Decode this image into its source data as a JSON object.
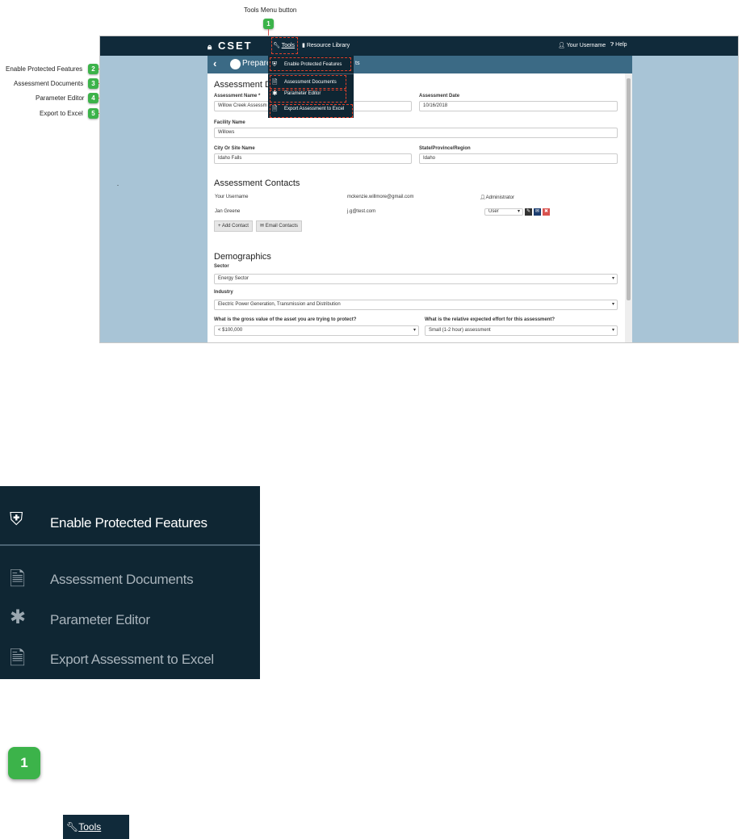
{
  "callouts": {
    "tools_menu_button": "Tools Menu button",
    "enable_protected_features": "Enable Protected Features",
    "assessment_documents": "Assessment Documents",
    "parameter_editor": "Parameter Editor",
    "export_to_excel": "Export to Excel",
    "badges": [
      "1",
      "2",
      "3",
      "4",
      "5"
    ]
  },
  "navbar": {
    "brand": "CSET",
    "tools": "Tools",
    "resource_library": "Resource Library",
    "username": "Your Username",
    "help": "Help"
  },
  "subheader": {
    "back": "‹",
    "title_visible": "Prepare",
    "tab_suffix": "ts"
  },
  "dropdown": {
    "items": [
      "Enable Protected Features",
      "Assessment Documents",
      "Parameter Editor",
      "Export Assessment to Excel"
    ]
  },
  "assessment_details": {
    "heading": "Assessment D",
    "name_label": "Assessment Name *",
    "name_value": "Willow Creek Assessm",
    "date_label": "Assessment Date",
    "date_value": "10/16/2018",
    "facility_label": "Facility Name",
    "facility_value": "Willows",
    "city_label": "City Or Site Name",
    "city_value": "Idaho Falls",
    "state_label": "State/Province/Region",
    "state_value": "Idaho"
  },
  "contacts": {
    "heading": "Assessment Contacts",
    "rows": [
      {
        "name": "Your Username",
        "email": "mckenzie.willmore@gmail.com",
        "role": "Administrator"
      },
      {
        "name": "Jan Greene",
        "email": "j.g@test.com",
        "role": "User"
      }
    ],
    "add_contact": "+ Add Contact",
    "email_contacts": "✉ Email Contacts"
  },
  "demographics": {
    "heading": "Demographics",
    "sector_label": "Sector",
    "sector_value": "Energy Sector",
    "industry_label": "Industry",
    "industry_value": "Electric Power Generation, Transmission and Distribution",
    "asset_label": "What is the gross value of the asset you are trying to protect?",
    "asset_value": "< $100,000",
    "effort_label": "What is the relative expected effort for this assessment?",
    "effort_value": "Small (1-2 hour) assessment"
  },
  "zoom_menu": {
    "items": [
      "Enable Protected Features",
      "Assessment Documents",
      "Parameter Editor",
      "Export Assessment to Excel"
    ]
  },
  "bottom": {
    "badge": "1",
    "tools_label": "Tools"
  },
  "colors": {
    "navbar": "#102a3a",
    "badge_green": "#3cb34a",
    "highlight_red": "#e2412b"
  }
}
